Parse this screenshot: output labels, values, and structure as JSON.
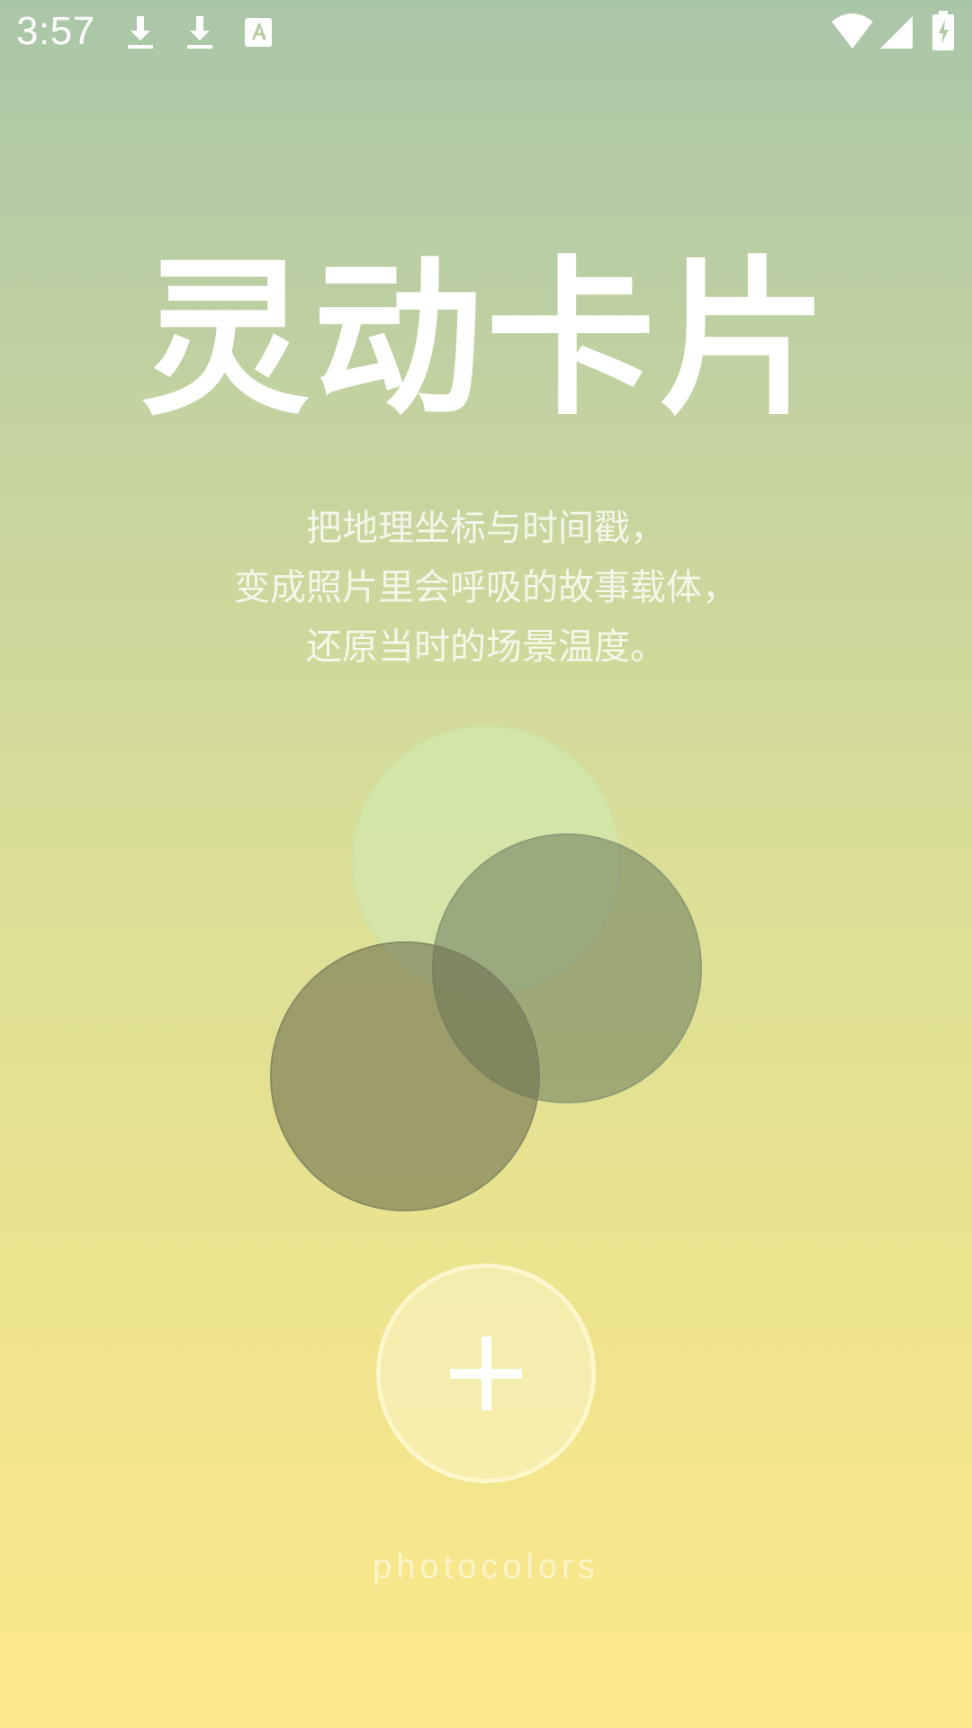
{
  "status_bar": {
    "time": "3:57",
    "left_icons": [
      "download-icon",
      "download-icon",
      "font-icon"
    ],
    "right_icons": [
      "wifi-icon",
      "signal-icon",
      "battery-charging-icon"
    ]
  },
  "main": {
    "title": "灵动卡片",
    "description_lines": [
      "把地理坐标与时间戳，",
      "变成照片里会呼吸的故事载体，",
      "还原当时的场景温度。"
    ],
    "add_button_icon": "plus-icon",
    "brand": "photocolors"
  },
  "colors": {
    "gradient_top": "#aac6a8",
    "gradient_bottom": "#fde98a",
    "circle_light": "#d4e6aa",
    "circle_mid": "#9eae80",
    "circle_dark": "#989a6c"
  }
}
